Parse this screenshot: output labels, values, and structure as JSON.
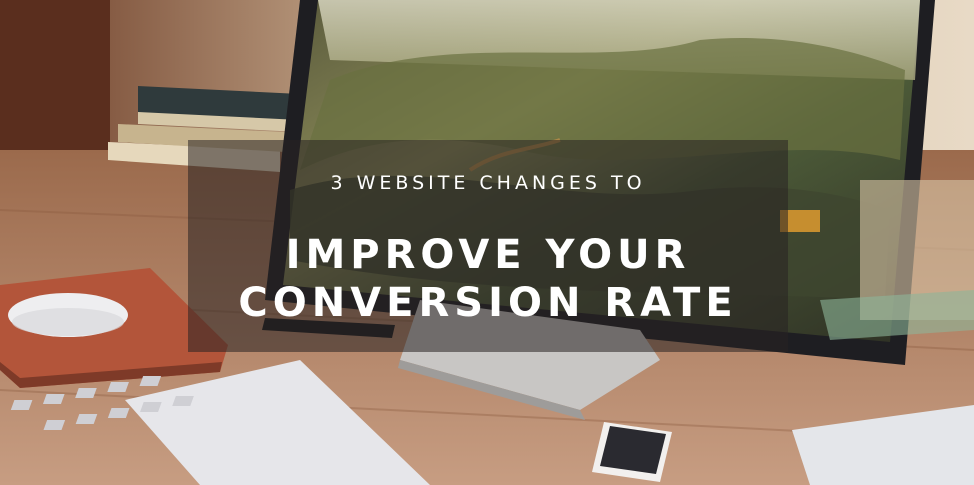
{
  "headline": {
    "subtitle": "3 WEBSITE CHANGES TO",
    "title_line1": "IMPROVE YOUR",
    "title_line2": "CONVERSION RATE"
  },
  "colors": {
    "overlay": "#282222",
    "text": "#ffffff",
    "mousepad": "#b3553a",
    "desk": "#a87658"
  }
}
